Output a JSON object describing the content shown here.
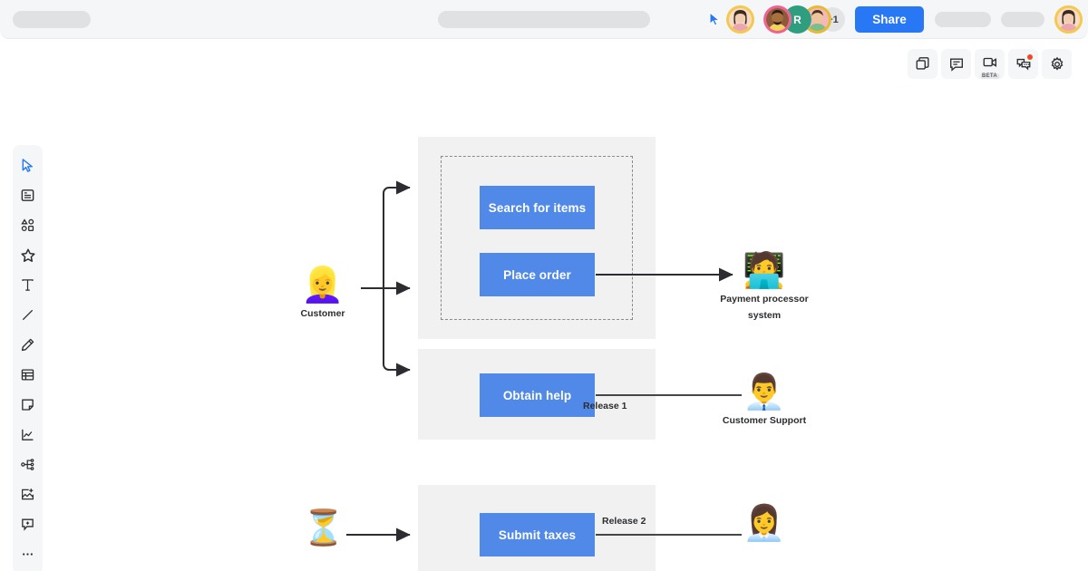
{
  "app": {
    "title": "Whiteboard canvas — User story map"
  },
  "topbar": {
    "share_label": "Share",
    "overflow_count": "+1",
    "avatar_initial": "R",
    "cursor_icon": "pointer-cursor-icon",
    "placeholders": {
      "left": "",
      "center": "",
      "right_one": "",
      "right_two": ""
    }
  },
  "top_tools": [
    {
      "name": "frames-icon",
      "label": "Frames",
      "badge": ""
    },
    {
      "name": "comment-icon",
      "label": "Comment",
      "badge": ""
    },
    {
      "name": "video-icon",
      "label": "Video chat",
      "badge": "BETA"
    },
    {
      "name": "chat-icon",
      "label": "Chat",
      "badge": ""
    },
    {
      "name": "gear-icon",
      "label": "Settings",
      "badge": ""
    }
  ],
  "left_tools": [
    {
      "name": "cursor-icon",
      "label": "Select",
      "active": true
    },
    {
      "name": "sticky-note-icon",
      "label": "Sticky note",
      "active": false
    },
    {
      "name": "shapes-icon",
      "label": "Shapes",
      "active": false
    },
    {
      "name": "template-star-icon",
      "label": "Templates",
      "active": false
    },
    {
      "name": "text-icon",
      "label": "Text",
      "active": false
    },
    {
      "name": "line-icon",
      "label": "Line",
      "active": false
    },
    {
      "name": "pen-icon",
      "label": "Pen",
      "active": false
    },
    {
      "name": "table-icon",
      "label": "Table",
      "active": false
    },
    {
      "name": "card-icon",
      "label": "Card",
      "active": false
    },
    {
      "name": "chart-icon",
      "label": "Chart",
      "active": false
    },
    {
      "name": "mindmap-icon",
      "label": "Mind map",
      "active": false
    },
    {
      "name": "image-add-icon",
      "label": "Add image",
      "active": false
    },
    {
      "name": "comment-add-icon",
      "label": "Add comment",
      "active": false
    },
    {
      "name": "more-icon",
      "label": "More",
      "active": false
    }
  ],
  "diagram": {
    "type": "user-story-map",
    "accent_color": "#5089e8",
    "lane_color": "#f1f1f1",
    "lanes": [
      {
        "id": "lane-1",
        "release_label": "Release 1",
        "dashed": true,
        "stories": [
          "Search for items",
          "Place order"
        ]
      },
      {
        "id": "lane-2",
        "release_label": "Release 2",
        "dashed": false,
        "stories": [
          "Obtain help"
        ]
      },
      {
        "id": "lane-3",
        "release_label": "",
        "dashed": false,
        "stories": [
          "Submit taxes"
        ]
      }
    ],
    "stories": {
      "search": "Search for items",
      "place": "Place order",
      "help": "Obtain help",
      "taxes": "Submit taxes"
    },
    "actors": {
      "customer": {
        "name": "Customer",
        "glyph": "👱‍♀️"
      },
      "payment": {
        "name": "Payment processor\nsystem",
        "glyph": "🧑‍💻"
      },
      "support": {
        "name": "Customer Support",
        "glyph": "👨‍💼"
      },
      "clerk": {
        "name": "",
        "glyph": "👩‍💼"
      },
      "timer": {
        "name": "",
        "glyph": "⏳"
      }
    },
    "releases": {
      "release_1": "Release 1",
      "release_2": "Release 2"
    }
  }
}
